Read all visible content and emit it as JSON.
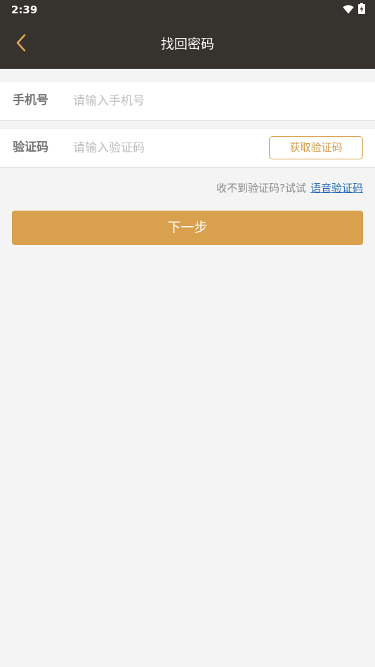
{
  "status_bar": {
    "time": "2:39",
    "icons": [
      "wifi-icon",
      "battery-charging-icon"
    ]
  },
  "app_bar": {
    "title": "找回密码",
    "back_icon": "chevron-left-icon"
  },
  "form": {
    "phone": {
      "label": "手机号",
      "placeholder": "请输入手机号",
      "value": ""
    },
    "code": {
      "label": "验证码",
      "placeholder": "请输入验证码",
      "value": "",
      "get_code_label": "获取验证码"
    },
    "hint": {
      "text": "收不到验证码?试试",
      "voice_link": "语音验证码"
    },
    "next_label": "下一步"
  },
  "colors": {
    "app_bar_bg": "#36322d",
    "accent": "#d9a04e",
    "link": "#2c6eb5",
    "page_bg": "#f4f4f4"
  }
}
